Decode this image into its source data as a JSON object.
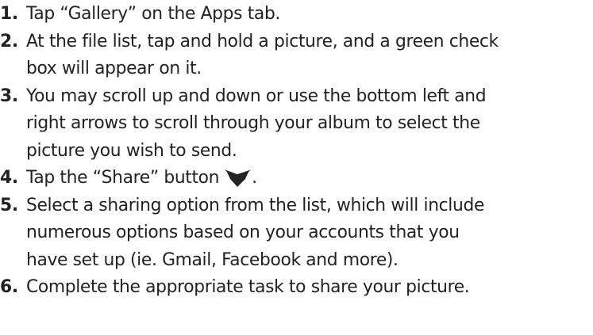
{
  "steps": [
    {
      "number": "1.",
      "lines": [
        "Tap “Gallery” on the Apps tab."
      ]
    },
    {
      "number": "2.",
      "lines": [
        "At the file list, tap and hold a picture, and a green check",
        "box will appear on it."
      ]
    },
    {
      "number": "3.",
      "lines": [
        "You may scroll up and down or use the bottom left and",
        "right arrows to scroll through your album to select the",
        "picture you wish to send."
      ]
    },
    {
      "number": "4.",
      "text_before_icon": "Tap the “Share” button",
      "icon": "share-icon",
      "text_after_icon": "."
    },
    {
      "number": "5.",
      "lines": [
        "Select a sharing option from the list, which will include",
        "numerous options based on your accounts that you",
        "have set up (ie. Gmail, Facebook and more)."
      ]
    },
    {
      "number": "6.",
      "lines": [
        "Complete the appropriate task to share your picture."
      ]
    }
  ]
}
